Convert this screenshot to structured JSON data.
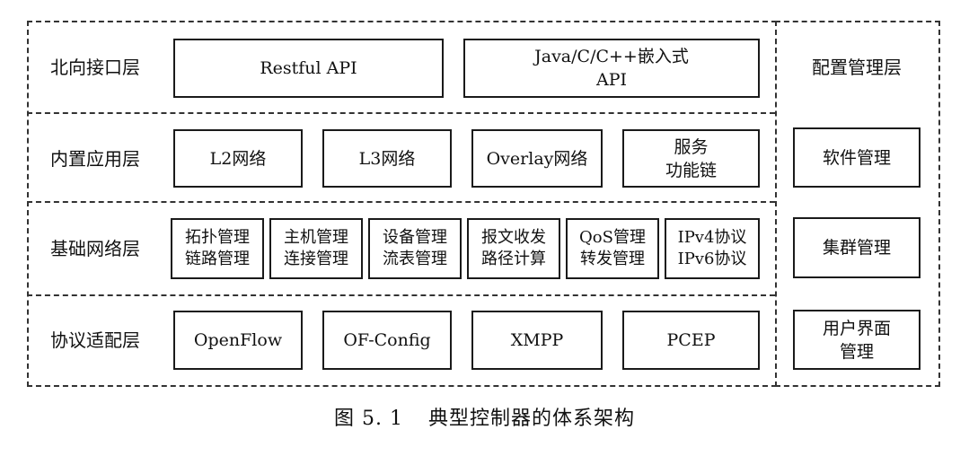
{
  "layers": [
    {
      "label": "北向接口层",
      "boxes": [
        {
          "lines": [
            "Restful API"
          ]
        },
        {
          "lines": [
            "Java/C/C++嵌入式",
            "API"
          ]
        }
      ]
    },
    {
      "label": "内置应用层",
      "boxes": [
        {
          "lines": [
            "L2网络"
          ]
        },
        {
          "lines": [
            "L3网络"
          ]
        },
        {
          "lines": [
            "Overlay网络"
          ]
        },
        {
          "lines": [
            "服务",
            "功能链"
          ]
        }
      ]
    },
    {
      "label": "基础网络层",
      "boxes": [
        {
          "lines": [
            "拓扑管理",
            "链路管理"
          ]
        },
        {
          "lines": [
            "主机管理",
            "连接管理"
          ]
        },
        {
          "lines": [
            "设备管理",
            "流表管理"
          ]
        },
        {
          "lines": [
            "报文收发",
            "路径计算"
          ]
        },
        {
          "lines": [
            "QoS管理",
            "转发管理"
          ]
        },
        {
          "lines": [
            "IPv4协议",
            "IPv6协议"
          ]
        }
      ]
    },
    {
      "label": "协议适配层",
      "boxes": [
        {
          "lines": [
            "OpenFlow"
          ]
        },
        {
          "lines": [
            "OF-Config"
          ]
        },
        {
          "lines": [
            "XMPP"
          ]
        },
        {
          "lines": [
            "PCEP"
          ]
        }
      ]
    }
  ],
  "config_panel": {
    "title": "配置管理层",
    "boxes": [
      {
        "lines": [
          "软件管理"
        ]
      },
      {
        "lines": [
          "集群管理"
        ]
      },
      {
        "lines": [
          "用户界面",
          "管理"
        ]
      }
    ]
  },
  "caption": {
    "number": "图 5. 1",
    "text": "典型控制器的体系架构"
  }
}
